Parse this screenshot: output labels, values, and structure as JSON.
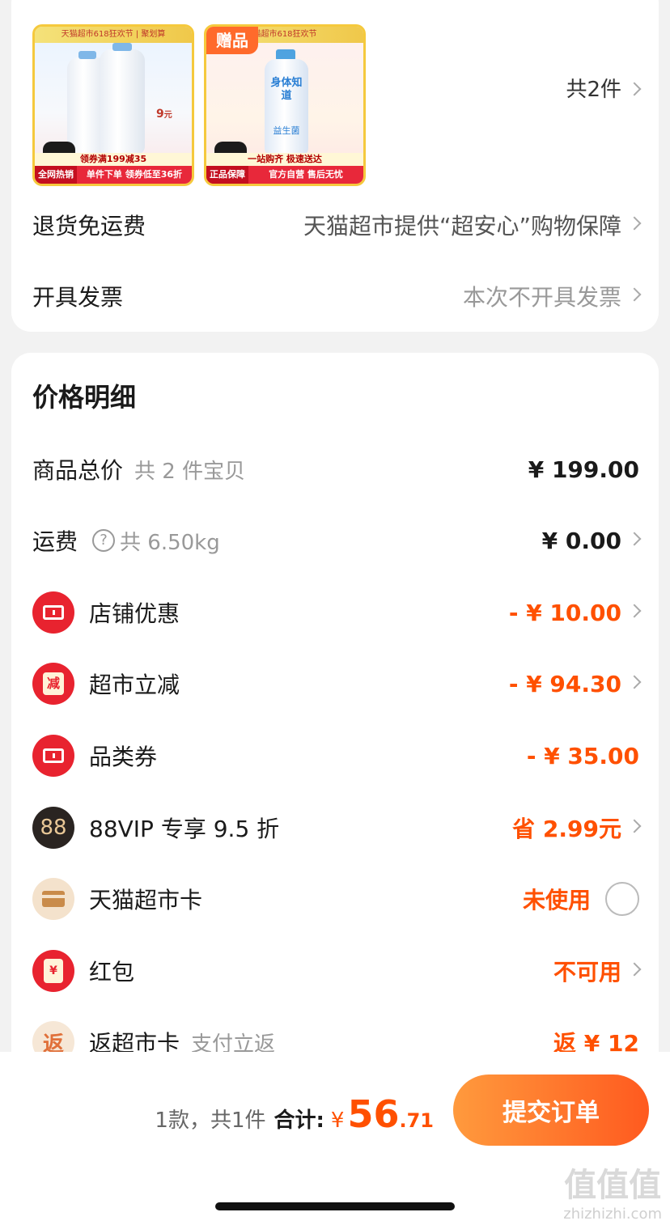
{
  "products": {
    "p1": {
      "band_top": "天猫超市618狂欢节 | 聚划算",
      "promo": "领券满199减35",
      "tag": "全网热销",
      "bottom": "单件下单 领券低至36折",
      "price_label": "9",
      "unit": "元"
    },
    "p2": {
      "gift": "赠品",
      "band_top": "猫超市618狂欢节",
      "bottle_text": "身体知道",
      "bottle_sub": "益生菌",
      "promo": "一站购齐 极速送达",
      "tag": "正品保障",
      "bottom": "官方自营 售后无忧"
    },
    "count": "共2件"
  },
  "rows": {
    "return": {
      "label": "退货免运费",
      "value": "天猫超市提供“超安心”购物保障"
    },
    "invoice": {
      "label": "开具发票",
      "value": "本次不开具发票"
    }
  },
  "price": {
    "title": "价格明细",
    "items": [
      {
        "label": "商品总价",
        "sub": "共 2 件宝贝",
        "value": "¥ 199.00"
      },
      {
        "label": "运费",
        "sub": "共 6.50kg",
        "value": "¥ 0.00"
      },
      {
        "label": "店铺优惠",
        "value": "- ¥ 10.00"
      },
      {
        "label": "超市立减",
        "value": "- ¥ 94.30",
        "icon_text": "减"
      },
      {
        "label": "品类券",
        "value": "- ¥ 35.00"
      },
      {
        "label": "88VIP 专享 9.5 折",
        "value": "省 2.99元",
        "icon_text": "88"
      },
      {
        "label": "天猫超市卡",
        "value": "未使用"
      },
      {
        "label": "红包",
        "value": "不可用",
        "icon_text": "¥"
      },
      {
        "label": "返超市卡",
        "sub": "支付立返",
        "value": "返 ¥ 12",
        "icon_text": "返"
      }
    ]
  },
  "footer": {
    "count": "1款，共1件",
    "total_label": "合计:",
    "currency": "¥",
    "int": "56",
    "dec": ".71",
    "submit": "提交订单"
  },
  "watermark": {
    "glyphs": "值值值",
    "site": "zhizhizhi.com"
  },
  "colors": {
    "accent": "#ff5000",
    "button_start": "#ff9a3d",
    "button_end": "#ff5a1f",
    "icon_red": "#e8232f"
  }
}
